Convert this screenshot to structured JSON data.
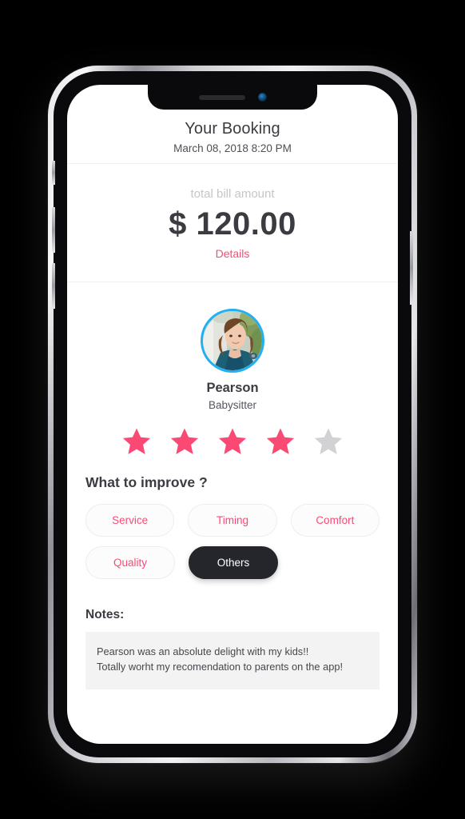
{
  "device": {
    "notch": {
      "speaker": "speaker-grille",
      "camera": "front-camera"
    },
    "buttons": [
      "silent-switch",
      "volume-up",
      "volume-down",
      "power-button"
    ]
  },
  "colors": {
    "accent_pink": "#FA4A74",
    "star_empty": "#D2D2D4",
    "selected_chip_bg": "#24262B",
    "avatar_ring": "#23B0F0",
    "notes_bg": "#F3F3F3",
    "muted_gray": "#C6C6CA"
  },
  "header": {
    "title": "Your Booking",
    "subtitle": "March 08, 2018 8:20 PM"
  },
  "bill": {
    "label": "total bill amount",
    "amount": "$ 120.00",
    "details_link": "Details"
  },
  "profile": {
    "name": "Pearson",
    "role": "Babysitter",
    "avatar_alt": "profile photo of a woman in a teal jacket outdoors"
  },
  "rating": {
    "value": 4,
    "max": 5,
    "stars": [
      true,
      true,
      true,
      true,
      false
    ]
  },
  "improve": {
    "title": "What to improve ?",
    "chips": [
      {
        "label": "Service",
        "selected": false
      },
      {
        "label": "Timing",
        "selected": false
      },
      {
        "label": "Comfort",
        "selected": false
      },
      {
        "label": "Quality",
        "selected": false
      },
      {
        "label": "Others",
        "selected": true
      }
    ]
  },
  "notes": {
    "label": "Notes:",
    "line1": "Pearson was an absolute delight with my kids!!",
    "line2": "Totally worht my recomendation to parents on the app!"
  }
}
